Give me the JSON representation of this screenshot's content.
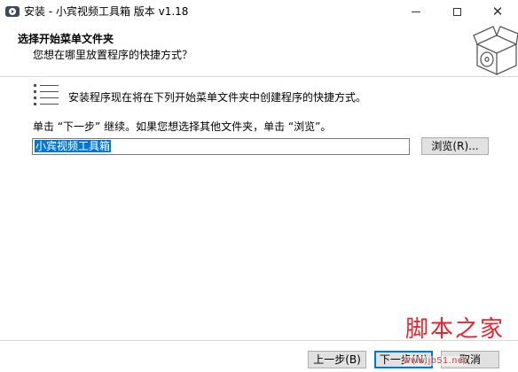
{
  "window": {
    "title": "安装 - 小宾视频工具箱 版本 v1.18",
    "controls": {
      "minimize": "minimize-icon",
      "maximize": "maximize-icon",
      "close": "✕"
    }
  },
  "header": {
    "title": "选择开始菜单文件夹",
    "subtitle": "您想在哪里放置程序的快捷方式？"
  },
  "body": {
    "intro": "安装程序现在将在下列开始菜单文件夹中创建程序的快捷方式。",
    "instruction": "单击 “下一步” 继续。如果您想选择其他文件夹，单击 “浏览”。",
    "folder_value": "小宾视频工具箱",
    "browse_label": "浏览(R)..."
  },
  "footer": {
    "back_label": "上一步(B)",
    "next_label": "下一步(N)",
    "cancel_label": "取消"
  },
  "watermark": {
    "logo_text": "脚本之家",
    "url": "www.jb51.net"
  },
  "colors": {
    "selection": "#0078d7",
    "default_button_border": "#0078d7",
    "watermark": "#e8252e"
  }
}
